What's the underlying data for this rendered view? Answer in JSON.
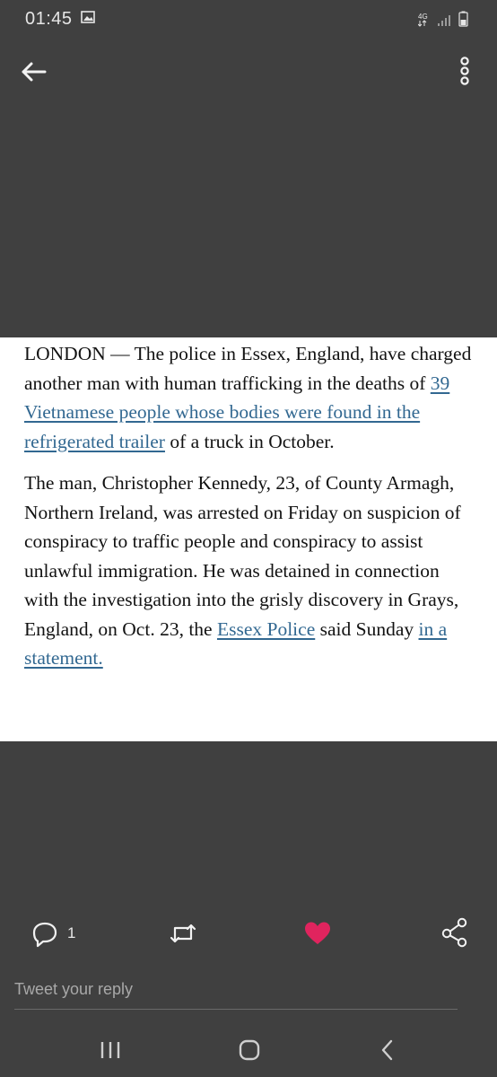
{
  "status_bar": {
    "time": "01:45",
    "icons": [
      "image-icon",
      "data-arrows-icon",
      "signal-icon",
      "battery-icon"
    ]
  },
  "top_bar": {
    "back_icon": "back-arrow-icon",
    "menu_icon": "more-vertical-icon"
  },
  "article": {
    "paragraph1": {
      "text_before": "LONDON — The police in Essex, England, have charged another man with human trafficking in the deaths of ",
      "link_text": "39 Vietnamese people whose bodies were found in the refrigerated trailer",
      "text_after": " of a truck in October."
    },
    "paragraph2": {
      "text_before": "The man, Christopher Kennedy, 23, of County Armagh, Northern Ireland, was arrested on Friday on suspicion of conspiracy to traffic people and conspiracy to assist unlawful immigration. He was detained in connection with the investigation into the grisly discovery in Grays, England, on Oct. 23, the ",
      "link1_text": "Essex Police",
      "text_middle": " said Sunday ",
      "link2_text": "in a statement."
    }
  },
  "actions": {
    "reply_count": "1",
    "icons": [
      "reply-icon",
      "retweet-icon",
      "like-heart-icon",
      "share-icon"
    ],
    "like_color": "#e0245e"
  },
  "reply": {
    "placeholder": "Tweet your reply"
  },
  "nav_bar": {
    "icons": [
      "recent-apps-icon",
      "home-icon",
      "back-icon"
    ]
  }
}
